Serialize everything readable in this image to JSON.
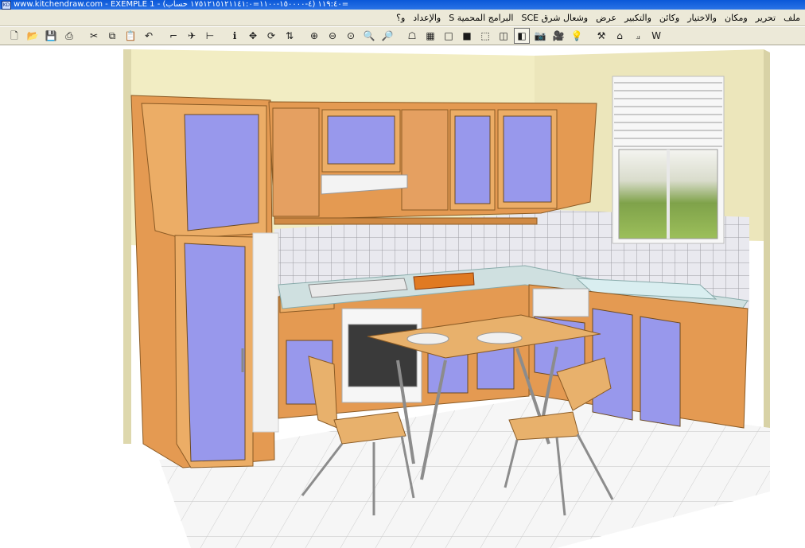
{
  "window": {
    "title": "www.kitchendraw.com - EXEMPLE 1 - (١١٩:٤٠ (٤-١٥٠٠٠٠-١١٠٠=١٧٥١٢١٥١٢١١٤١:٠ حساب=",
    "app_icon_label": "KD"
  },
  "menu": {
    "items": [
      "ملف",
      "تحرير",
      "ومكان",
      "والاختيار",
      "وكائن",
      "والتكبير",
      "عرض",
      "وشعال شرق SCE",
      "البرامج المحمية S",
      "والإعداد",
      "و؟"
    ]
  },
  "toolbar": {
    "buttons": [
      {
        "name": "new-document-icon",
        "glyph": "🗋"
      },
      {
        "name": "open-folder-icon",
        "glyph": "📂"
      },
      {
        "name": "save-icon",
        "glyph": "💾"
      },
      {
        "name": "print-icon",
        "glyph": "⎙"
      },
      {
        "name": "cut-icon",
        "glyph": "✂"
      },
      {
        "name": "copy-icon",
        "glyph": "⧉"
      },
      {
        "name": "paste-icon",
        "glyph": "📋"
      },
      {
        "name": "undo-icon",
        "glyph": "↶"
      },
      {
        "name": "stairs-icon",
        "glyph": "⌐"
      },
      {
        "name": "place-object-icon",
        "glyph": "✈"
      },
      {
        "name": "dimension-icon",
        "glyph": "⊢"
      },
      {
        "name": "info-icon",
        "glyph": "ℹ"
      },
      {
        "name": "move-icon",
        "glyph": "✥"
      },
      {
        "name": "rotate-icon",
        "glyph": "⟳"
      },
      {
        "name": "flip-icon",
        "glyph": "⇅"
      },
      {
        "name": "zoom-in-icon",
        "glyph": "⊕"
      },
      {
        "name": "zoom-out-icon",
        "glyph": "⊖"
      },
      {
        "name": "zoom-fit-icon",
        "glyph": "⊙"
      },
      {
        "name": "zoom-window-icon",
        "glyph": "🔍"
      },
      {
        "name": "zoom-previous-icon",
        "glyph": "🔎"
      },
      {
        "name": "render-icon",
        "glyph": "☖"
      },
      {
        "name": "plan-view-icon",
        "glyph": "▦"
      },
      {
        "name": "wireframe-view-icon",
        "glyph": "□"
      },
      {
        "name": "color-view-icon",
        "glyph": "■"
      },
      {
        "name": "box-view-icon",
        "glyph": "⬚"
      },
      {
        "name": "solid-view-icon",
        "glyph": "◫"
      },
      {
        "name": "realistic-view-icon",
        "glyph": "◧"
      },
      {
        "name": "camera-icon",
        "glyph": "📷"
      },
      {
        "name": "photo-icon",
        "glyph": "🎥"
      },
      {
        "name": "light-icon",
        "glyph": "💡"
      },
      {
        "name": "tools-icon",
        "glyph": "⚒"
      },
      {
        "name": "walls-icon",
        "glyph": "⌂"
      },
      {
        "name": "path-icon",
        "glyph": "⟓"
      },
      {
        "name": "word-export-icon",
        "glyph": "W"
      }
    ],
    "pressed_index": 26
  },
  "colors": {
    "titlebar": "#0b58d8",
    "chrome": "#ece9d8",
    "cabinet_wood": "#e9a55b",
    "door_panel": "#9999ee",
    "wall": "#f0ebc0",
    "tiles": "#e8e8ee",
    "floor": "#f2f2f2",
    "counter": "#cfe0e0"
  }
}
